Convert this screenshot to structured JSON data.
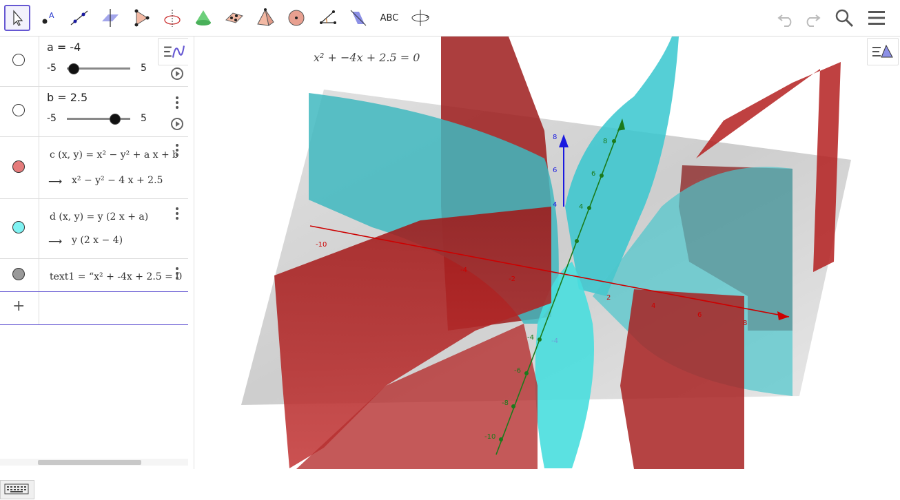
{
  "toolbar": {
    "tools": [
      "move-tool",
      "point-tool",
      "line-tool",
      "perpendicular-line-tool",
      "polygon-tool",
      "circle-axis-tool",
      "cone-tool",
      "plane-through-points-tool",
      "pyramid-tool",
      "sphere-tool",
      "angle-tool",
      "reflect-tool",
      "text-tool",
      "rotate-view-tool"
    ],
    "text_tool_label": "ABC",
    "selected_tool": "move-tool"
  },
  "algebra": {
    "slider_a": {
      "label": "a = -4",
      "min": "-5",
      "max": "5",
      "value": -4
    },
    "slider_b": {
      "label": "b = 2.5",
      "min": "-5",
      "max": "5",
      "value": 2.5
    },
    "func_c": {
      "definition": "c (x, y) = x² − y² + a x + b",
      "value": "x² − y² − 4 x + 2.5",
      "color": "#e57b7b"
    },
    "func_d": {
      "definition": "d (x, y) = y  (2 x + a)",
      "value": "y  (2 x − 4)",
      "color": "#7ff2f2"
    },
    "text1": {
      "definition": "text1  =  “x² + -4x + 2.5 = 0",
      "color": "#999999"
    }
  },
  "graphics": {
    "equation_text": "x² + −4x + 2.5 = 0",
    "x_ticks": [
      "-10",
      "-4",
      "-2",
      "2",
      "4",
      "6",
      "8"
    ],
    "y_ticks": [
      "8",
      "6",
      "4",
      "-4",
      "-6",
      "-8",
      "-10"
    ],
    "z_ticks": [
      "8",
      "6",
      "4",
      "-4"
    ],
    "colors": {
      "surface_c": "#b22222",
      "surface_d": "#4ccfd4",
      "x_axis": "#cc0000",
      "y_axis": "#1b7a1b",
      "z_axis": "#1a1ae0"
    }
  }
}
